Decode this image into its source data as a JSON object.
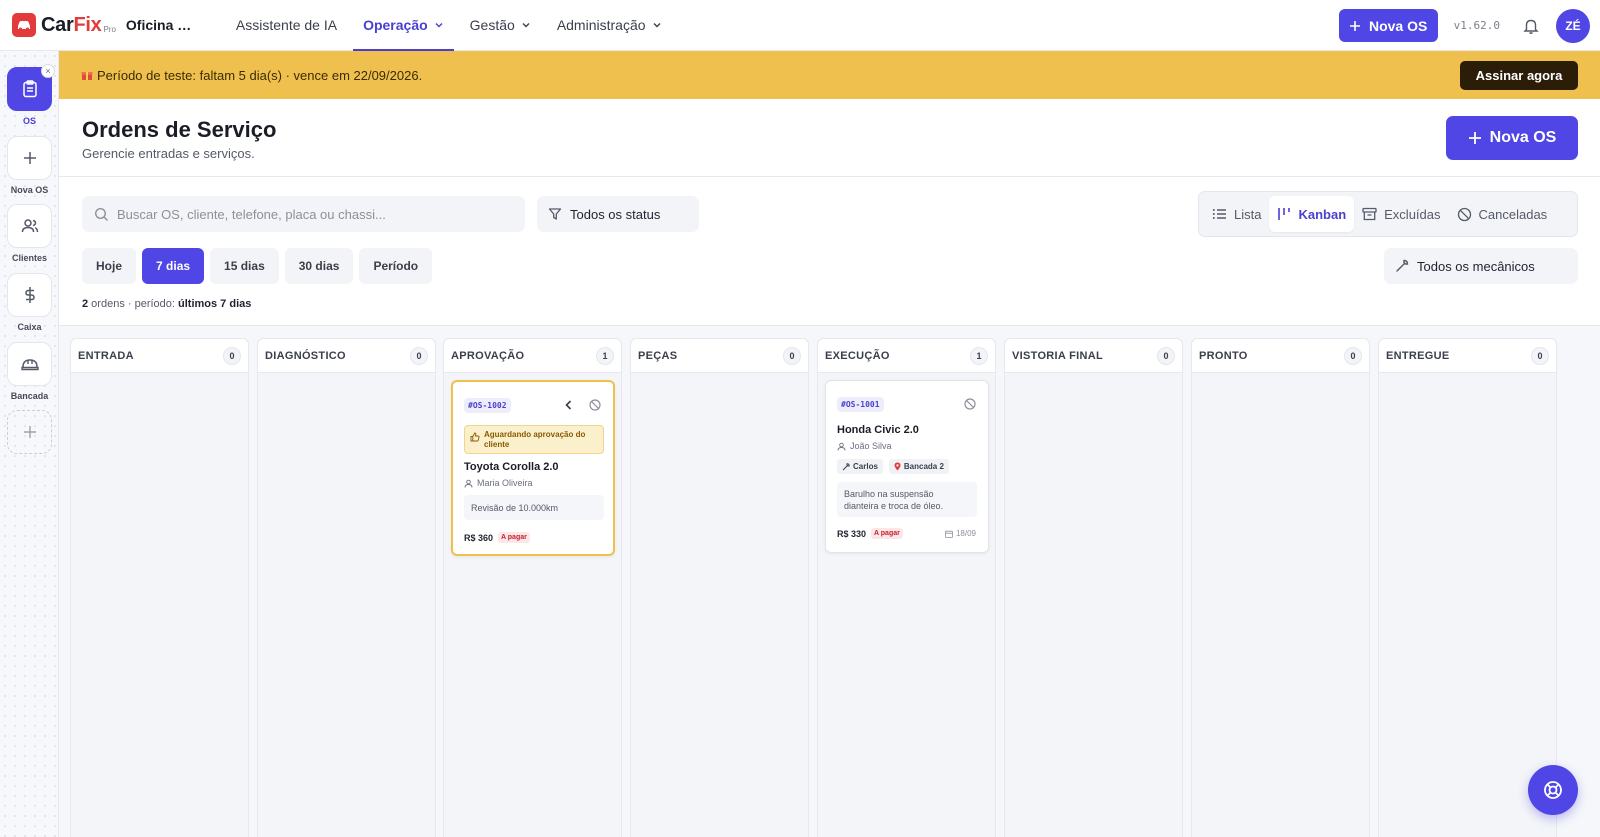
{
  "brand": {
    "car": "Car",
    "fix": "Fix",
    "tier": "Pro",
    "shop": "Oficina Modelo"
  },
  "nav": [
    {
      "label": "Assistente de IA",
      "dropdown": false,
      "active": false
    },
    {
      "label": "Operação",
      "dropdown": true,
      "active": true
    },
    {
      "label": "Gestão",
      "dropdown": true,
      "active": false
    },
    {
      "label": "Administração",
      "dropdown": true,
      "active": false
    }
  ],
  "topbar": {
    "new_os": "Nova OS",
    "version": "v1.62.0",
    "avatar": "ZÉ"
  },
  "sidebar": [
    {
      "label": "OS",
      "icon": "clipboard-icon",
      "active": true
    },
    {
      "label": "Nova OS",
      "icon": "plus-icon",
      "active": false
    },
    {
      "label": "Clientes",
      "icon": "users-icon",
      "active": false
    },
    {
      "label": "Caixa",
      "icon": "dollar-icon",
      "active": false
    },
    {
      "label": "Bancada",
      "icon": "hardhat-icon",
      "active": false
    }
  ],
  "banner": {
    "text": "Período de teste: faltam 5 dia(s) · vence em 22/09/2026.",
    "button": "Assinar agora"
  },
  "header": {
    "title": "Ordens de Serviço",
    "subtitle": "Gerencie entradas e serviços.",
    "new_os": "Nova OS"
  },
  "filters": {
    "search_placeholder": "Buscar OS, cliente, telefone, placa ou chassi...",
    "status": "Todos os status",
    "views": [
      {
        "label": "Lista",
        "active": false
      },
      {
        "label": "Kanban",
        "active": true
      },
      {
        "label": "Excluídas",
        "active": false
      },
      {
        "label": "Canceladas",
        "active": false
      }
    ],
    "periods": [
      {
        "label": "Hoje",
        "active": false
      },
      {
        "label": "7 dias",
        "active": true
      },
      {
        "label": "15 dias",
        "active": false
      },
      {
        "label": "30 dias",
        "active": false
      },
      {
        "label": "Período",
        "active": false
      }
    ],
    "mechanics": "Todos os mecânicos",
    "count_number": "2",
    "count_text": " ordens · período: ",
    "count_period": "últimos 7 dias"
  },
  "columns": [
    {
      "title": "ENTRADA",
      "count": "0"
    },
    {
      "title": "DIAGNÓSTICO",
      "count": "0"
    },
    {
      "title": "APROVAÇÃO",
      "count": "1"
    },
    {
      "title": "PEÇAS",
      "count": "0"
    },
    {
      "title": "EXECUÇÃO",
      "count": "1"
    },
    {
      "title": "VISTORIA FINAL",
      "count": "0"
    },
    {
      "title": "PRONTO",
      "count": "0"
    },
    {
      "title": "ENTREGUE",
      "count": "0"
    }
  ],
  "cards": {
    "approval": {
      "id": "#OS-1002",
      "notice": "Aguardando aprovação do cliente",
      "vehicle": "Toyota Corolla 2.0",
      "client": "Maria Oliveira",
      "description": "Revisão de 10.000km",
      "price": "R$ 360",
      "payment": "A pagar"
    },
    "execution": {
      "id": "#OS-1001",
      "vehicle": "Honda Civic 2.0",
      "client": "João Silva",
      "mechanic": "Carlos",
      "bench": "Bancada 2",
      "description": "Barulho na suspensão dianteira e troca de óleo.",
      "price": "R$ 330",
      "payment": "A pagar",
      "date": "18/09"
    }
  },
  "colors": {
    "primary": "#4f46e5",
    "banner": "#f0c04e",
    "brand_red": "#e23b3b"
  }
}
